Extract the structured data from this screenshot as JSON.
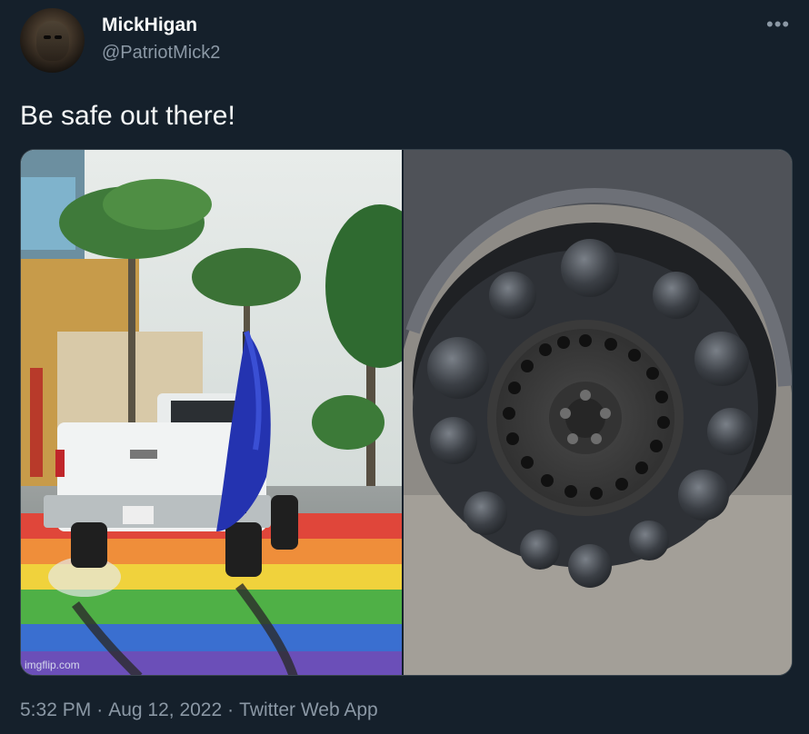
{
  "author": {
    "display_name": "MickHigan",
    "handle": "@PatriotMick2"
  },
  "more_icon": "more-dots-icon",
  "tweet": {
    "text": "Be safe out there!"
  },
  "media": {
    "watermark": "imgflip.com"
  },
  "footer": {
    "time": "5:32 PM",
    "separator": "·",
    "date": "Aug 12, 2022",
    "source": "Twitter Web App"
  },
  "colors": {
    "background": "#15202b",
    "text_primary": "#f7f9f9",
    "text_secondary": "#8b98a5",
    "border": "#38444d"
  }
}
